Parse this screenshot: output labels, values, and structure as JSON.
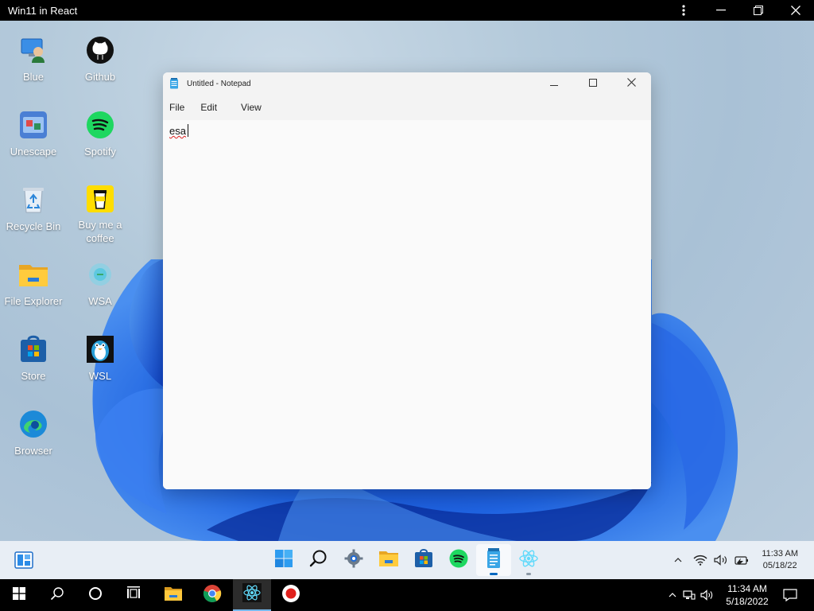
{
  "host": {
    "title": "Win11 in React",
    "icons": [
      "more-vertical-icon",
      "minimize-icon",
      "restore-icon",
      "close-icon"
    ]
  },
  "desktop": {
    "icons": [
      {
        "label": "Blue",
        "icon": "blue-user-icon"
      },
      {
        "label": "Github",
        "icon": "github-icon"
      },
      {
        "label": "Unescape",
        "icon": "unescape-icon"
      },
      {
        "label": "Spotify",
        "icon": "spotify-icon"
      },
      {
        "label": "Recycle Bin",
        "icon": "recycle-bin-icon"
      },
      {
        "label": "Buy me a coffee",
        "icon": "coffee-icon"
      },
      {
        "label": "File Explorer",
        "icon": "folder-icon"
      },
      {
        "label": "WSA",
        "icon": "wsa-icon"
      },
      {
        "label": "Store",
        "icon": "store-icon"
      },
      {
        "label": "WSL",
        "icon": "penguin-icon"
      },
      {
        "label": "Browser",
        "icon": "edge-icon"
      }
    ]
  },
  "notepad": {
    "title": "Untitled - Notepad",
    "menu": [
      "File",
      "Edit",
      "View"
    ],
    "content": "esa"
  },
  "taskbar": {
    "apps": [
      {
        "name": "start",
        "icon": "windows11-start-icon"
      },
      {
        "name": "search",
        "icon": "search-icon"
      },
      {
        "name": "settings",
        "icon": "gear-icon"
      },
      {
        "name": "file-explorer",
        "icon": "folder-icon"
      },
      {
        "name": "store",
        "icon": "store-icon"
      },
      {
        "name": "spotify",
        "icon": "spotify-icon"
      },
      {
        "name": "notepad",
        "icon": "notepad-icon",
        "active": true
      },
      {
        "name": "react",
        "icon": "react-icon"
      }
    ],
    "time": "11:33 AM",
    "date": "05/18/22"
  },
  "host_taskbar": {
    "time": "11:34 AM",
    "date": "5/18/2022"
  },
  "colors": {
    "accent": "#0067c0",
    "spotify": "#1ed760",
    "bloom": "#1a5ed6"
  }
}
